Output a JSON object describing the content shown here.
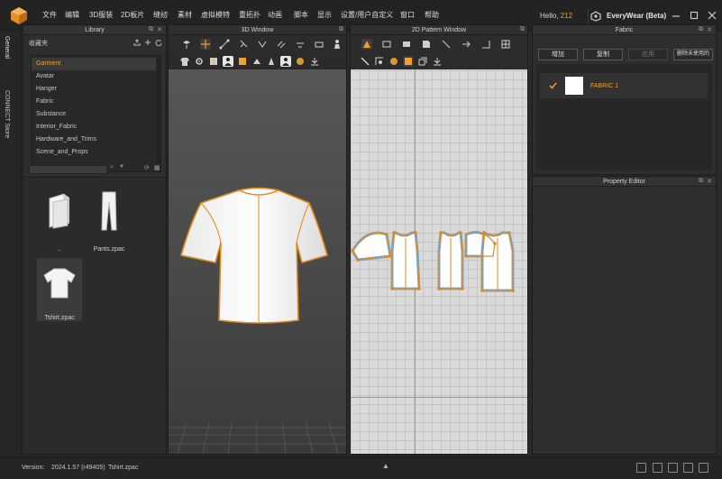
{
  "menubar": {
    "items": [
      "文件",
      "编辑",
      "3D服装",
      "2D板片",
      "缝纫",
      "素材",
      "虚拟模特",
      "重拓扑",
      "动画",
      "脚本",
      "显示",
      "设置/用户自定义",
      "窗口",
      "帮助"
    ],
    "greeting": "Hello,",
    "user": "212",
    "product": "EveryWear (Beta)"
  },
  "left_tabs": {
    "general": "General",
    "connect": "CONNECT Store"
  },
  "library": {
    "title": "Library",
    "favorites": "收藏夹",
    "items": [
      "Garment",
      "Avatar",
      "Hanger",
      "Fabric",
      "Substance",
      "Interior_Fabric",
      "Hardware_and_Trims",
      "Scene_and_Props"
    ],
    "selected_index": 0,
    "files": [
      {
        "name": "..",
        "icon": "folder-icon"
      },
      {
        "name": "Pants.zpac",
        "icon": "pants-icon"
      },
      {
        "name": "Tshirt.zpac",
        "icon": "tshirt-icon"
      }
    ]
  },
  "window3d": {
    "title": "3D Window"
  },
  "window2d": {
    "title": "2D Pattern Window"
  },
  "fabric": {
    "title": "Fabric",
    "buttons": {
      "add": "增加",
      "copy": "复制",
      "apply": "应用",
      "remove_unused": "删除未使用的"
    },
    "items": [
      {
        "name": "FABRIC 1",
        "swatch": "#ffffff",
        "checked": true
      }
    ]
  },
  "property_editor": {
    "title": "Property Editor"
  },
  "status": {
    "version_label": "Version:",
    "version": "2024.1.57 (r49405)",
    "file": "Tshirt.zpac"
  },
  "colors": {
    "accent": "#f0a030",
    "stitch": "#e08a1a",
    "pattern_outline": "#7aa7d6"
  }
}
